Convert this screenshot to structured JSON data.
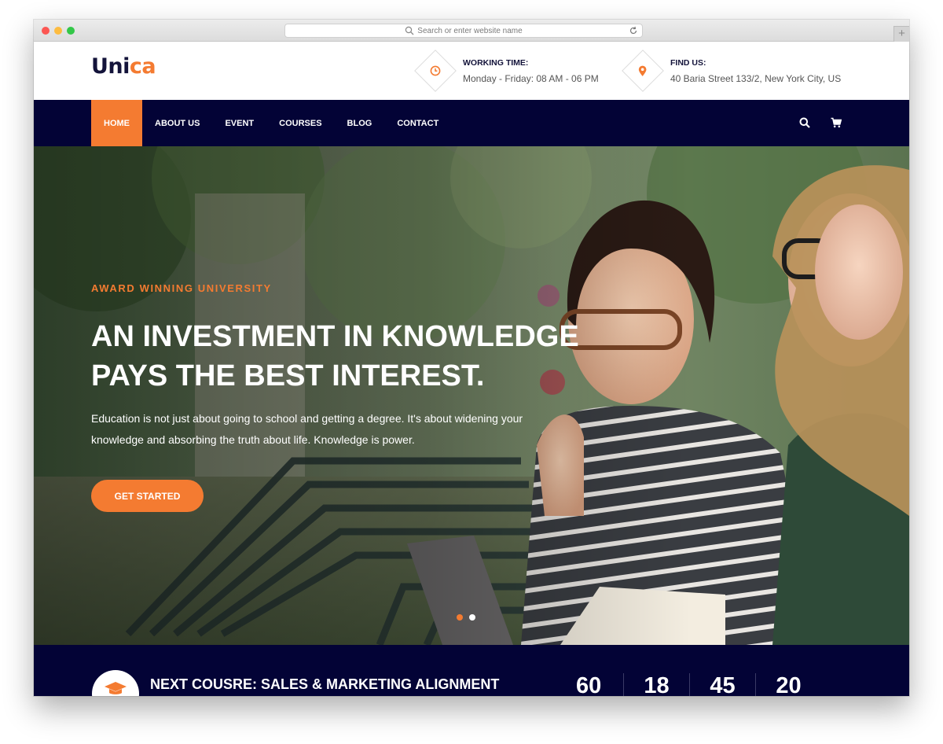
{
  "browser": {
    "url_placeholder": "Search or enter website name"
  },
  "brand": {
    "logo_part1": "Uni",
    "logo_part2": "ca",
    "accent_color": "#f47b31",
    "navy_color": "#030336"
  },
  "header": {
    "working": {
      "label": "WORKING TIME:",
      "value": "Monday - Friday: 08 AM - 06 PM",
      "icon": "clock-icon"
    },
    "find": {
      "label": "FIND US:",
      "value": "40 Baria Street 133/2, New York City, US",
      "icon": "map-pin-icon"
    }
  },
  "nav": {
    "items": [
      {
        "label": "HOME",
        "active": true
      },
      {
        "label": "ABOUT US"
      },
      {
        "label": "EVENT"
      },
      {
        "label": "COURSES"
      },
      {
        "label": "BLOG"
      },
      {
        "label": "CONTACT"
      }
    ],
    "icons": [
      "search-icon",
      "cart-icon"
    ]
  },
  "hero": {
    "eyebrow": "AWARD WINNING UNIVERSITY",
    "headline_line1": "AN INVESTMENT IN KNOWLEDGE",
    "headline_line2": "PAYS THE BEST INTEREST.",
    "subtext_line1": "Education is not just about going to school and getting a degree. It's about widening your",
    "subtext_line2": "knowledge and absorbing the truth about life. Knowledge is power.",
    "cta_label": "GET STARTED",
    "slides": 2,
    "active_slide": 1
  },
  "course_bar": {
    "title": "NEXT COUSRE: SALES & MARKETING ALIGNMENT",
    "icon": "graduation-cap-icon",
    "counters": [
      "60",
      "18",
      "45",
      "20"
    ]
  }
}
